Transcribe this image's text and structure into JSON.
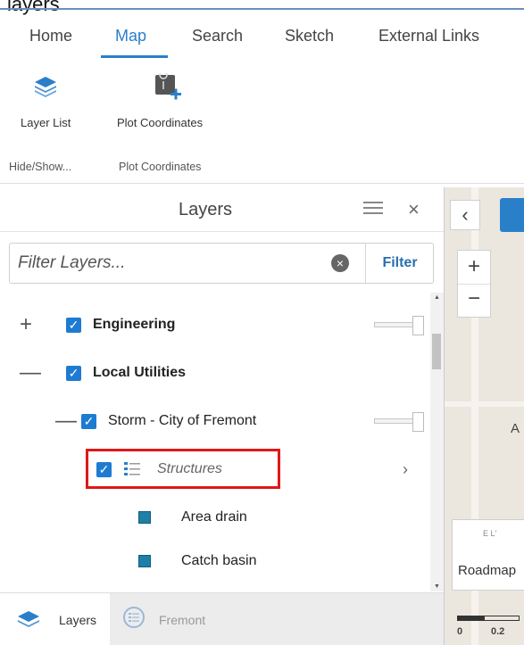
{
  "window": {
    "title": "layers"
  },
  "tabs": [
    {
      "label": "Home"
    },
    {
      "label": "Map"
    },
    {
      "label": "Search"
    },
    {
      "label": "Sketch"
    },
    {
      "label": "External Links"
    }
  ],
  "active_tab": "Map",
  "ribbon": {
    "tools": [
      {
        "label": "Layer List",
        "icon": "layers-icon"
      },
      {
        "label": "Plot Coordinates",
        "icon": "plot-coordinates-icon"
      }
    ],
    "groups": [
      {
        "label": "Hide/Show..."
      },
      {
        "label": "Plot Coordinates"
      }
    ]
  },
  "panel": {
    "title": "Layers",
    "filter": {
      "placeholder": "Filter Layers...",
      "value": "",
      "button_label": "Filter"
    }
  },
  "tree": [
    {
      "expander": "+",
      "label": "Engineering",
      "checked": true,
      "has_slider": true,
      "opacity": 1.0
    },
    {
      "expander": "—",
      "label": "Local Utilities",
      "checked": true,
      "has_slider": false
    },
    {
      "expander": "—",
      "label": "Storm - City of Fremont",
      "checked": true,
      "has_slider": true,
      "opacity": 1.0
    },
    {
      "label": "Structures",
      "checked": true,
      "has_chevron": true
    },
    {
      "label": "Area drain",
      "swatch": "#1f7fa6"
    },
    {
      "label": "Catch basin",
      "swatch": "#1f7fa6"
    }
  ],
  "bottom_tabs": [
    {
      "label": "Layers",
      "active": true
    },
    {
      "label": "Fremont",
      "active": false
    }
  ],
  "map": {
    "fragment_text": "A",
    "basemap_label": "Roadmap",
    "basemap_thumb_text": "E L'",
    "scale_labels": [
      "0",
      "0.2"
    ]
  },
  "colors": {
    "accent": "#2a7fc9",
    "checkbox": "#1e7bd2",
    "highlight": "#e01717"
  }
}
